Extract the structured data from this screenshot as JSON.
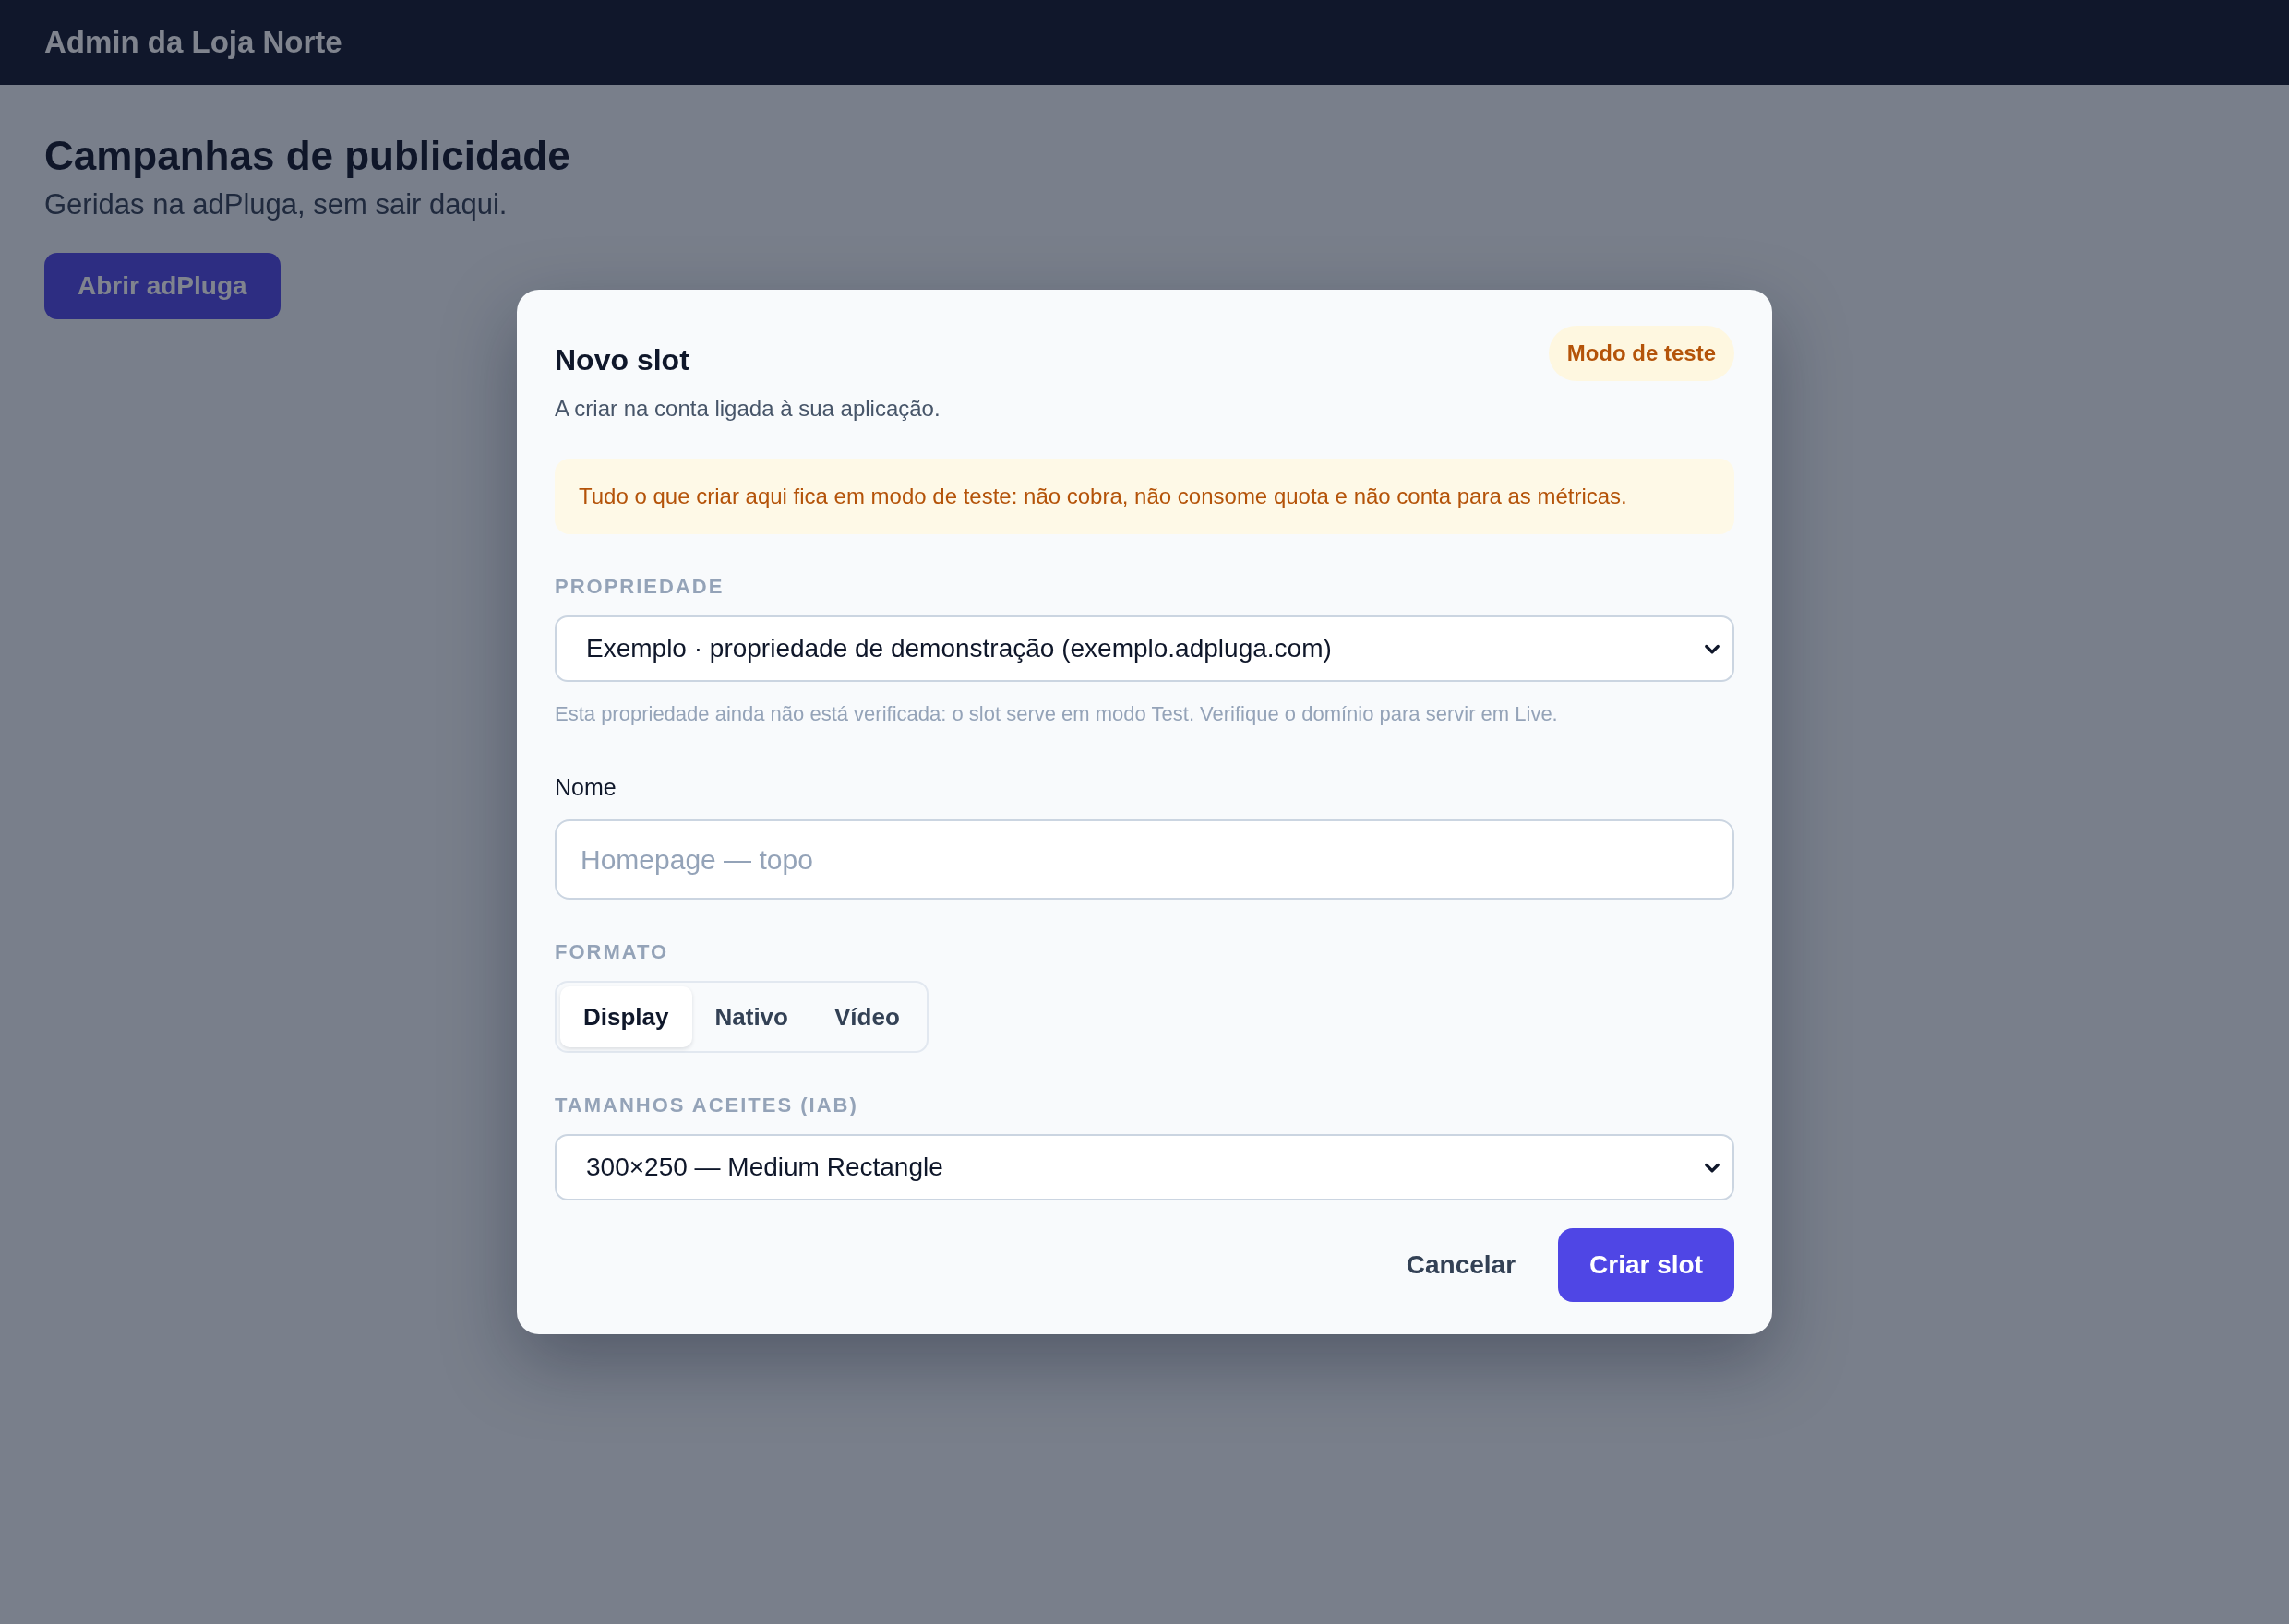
{
  "header": {
    "title": "Admin da Loja Norte"
  },
  "page": {
    "title": "Campanhas de publicidade",
    "subtitle": "Geridas na adPluga, sem sair daqui.",
    "button": "Abrir adPluga"
  },
  "modal": {
    "title": "Novo slot",
    "subtitle": "A criar na conta ligada à sua aplicação.",
    "badge": "Modo de teste",
    "notice": "Tudo o que criar aqui fica em modo de teste: não cobra, não consome quota e não conta para as métricas.",
    "property": {
      "label": "PROPRIEDADE",
      "value": "Exemplo · propriedade de demonstração (exemplo.adpluga.com)",
      "hint": "Esta propriedade ainda não está verificada: o slot serve em modo Test. Verifique o domínio para servir em Live."
    },
    "name": {
      "label": "Nome",
      "placeholder": "Homepage — topo"
    },
    "format": {
      "label": "FORMATO",
      "options": [
        {
          "label": "Display",
          "selected": true
        },
        {
          "label": "Nativo",
          "selected": false
        },
        {
          "label": "Vídeo",
          "selected": false
        }
      ]
    },
    "sizes": {
      "label": "TAMANHOS ACEITES (IAB)",
      "value": "300×250 — Medium Rectangle"
    },
    "actions": [
      {
        "label": "Cancelar",
        "kind": "secondary"
      },
      {
        "label": "Criar slot",
        "kind": "primary"
      }
    ]
  }
}
